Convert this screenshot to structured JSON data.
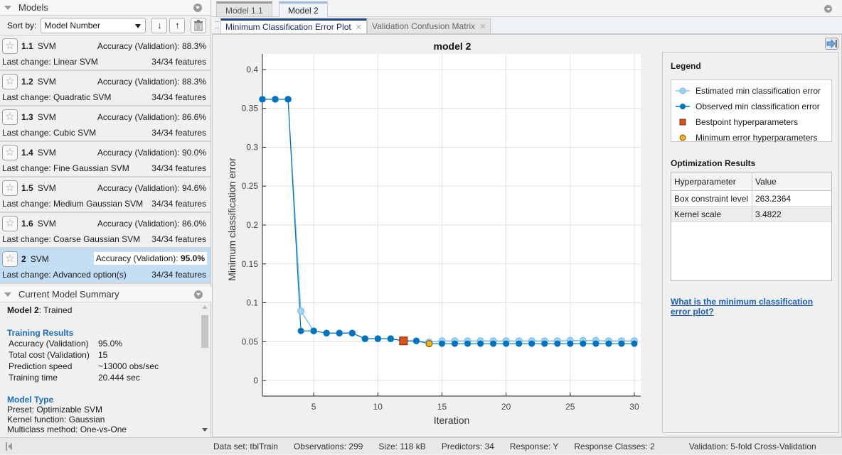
{
  "models_panel": {
    "title": "Models",
    "sort_label": "Sort by:",
    "sort_value": "Model Number",
    "models": [
      {
        "id": "1.1",
        "type": "SVM",
        "accuracy": "Accuracy (Validation): 88.3%",
        "last_change": "Last change: Linear SVM",
        "features": "34/34 features"
      },
      {
        "id": "1.2",
        "type": "SVM",
        "accuracy": "Accuracy (Validation): 88.3%",
        "last_change": "Last change: Quadratic SVM",
        "features": "34/34 features"
      },
      {
        "id": "1.3",
        "type": "SVM",
        "accuracy": "Accuracy (Validation): 86.6%",
        "last_change": "Last change: Cubic SVM",
        "features": "34/34 features"
      },
      {
        "id": "1.4",
        "type": "SVM",
        "accuracy": "Accuracy (Validation): 90.0%",
        "last_change": "Last change: Fine Gaussian SVM",
        "features": "34/34 features"
      },
      {
        "id": "1.5",
        "type": "SVM",
        "accuracy": "Accuracy (Validation): 94.6%",
        "last_change": "Last change: Medium Gaussian SVM",
        "features": "34/34 features"
      },
      {
        "id": "1.6",
        "type": "SVM",
        "accuracy": "Accuracy (Validation): 86.0%",
        "last_change": "Last change: Coarse Gaussian SVM",
        "features": "34/34 features"
      },
      {
        "id": "2",
        "type": "SVM",
        "accuracy_label": "Accuracy (Validation):",
        "accuracy_value": "95.0%",
        "last_change": "Last change: Advanced option(s)",
        "features": "34/34 features",
        "selected": true
      }
    ]
  },
  "summary_panel": {
    "title": "Current Model Summary",
    "model_name": "Model 2",
    "model_status": ": Trained",
    "training_results_title": "Training Results",
    "training_results": [
      {
        "k": "Accuracy (Validation)",
        "v": "95.0%"
      },
      {
        "k": "Total cost (Validation)",
        "v": "15"
      },
      {
        "k": "Prediction speed",
        "v": "~13000 obs/sec"
      },
      {
        "k": "Training time",
        "v": "20.444 sec"
      }
    ],
    "model_type_title": "Model Type",
    "model_type": [
      "Preset: Optimizable SVM",
      "Kernel function: Gaussian",
      "Multiclass method: One-vs-One"
    ]
  },
  "doc_tabs": [
    "Model 1.1",
    "Model 2"
  ],
  "plot_tabs": [
    "Minimum Classification Error Plot",
    "Validation Confusion Matrix"
  ],
  "side_panel": {
    "legend_title": "Legend",
    "legend": [
      "Estimated min classification error",
      "Observed min classification error",
      "Bestpoint hyperparameters",
      "Minimum error hyperparameters"
    ],
    "optimization_title": "Optimization Results",
    "table_headers": [
      "Hyperparameter",
      "Value"
    ],
    "table_rows": [
      [
        "Box constraint level",
        "263.2364"
      ],
      [
        "Kernel scale",
        "3.4822"
      ]
    ],
    "help_link": "What is the minimum classification error plot?"
  },
  "status_bar": {
    "dataset": "Data set: tblTrain",
    "observations": "Observations: 299",
    "size": "Size: 118 kB",
    "predictors": "Predictors: 34",
    "response": "Response: Y",
    "classes": "Response Classes: 2",
    "validation": "Validation: 5-fold Cross-Validation"
  },
  "colors": {
    "observed": "#0072bd",
    "estimated": "#9fd3f5",
    "bestpoint": "#d95319",
    "minerror": "#edb120",
    "selected_row": "#c3def4",
    "link": "#1a5fb4"
  },
  "chart_data": {
    "type": "line",
    "title": "model 2",
    "xlabel": "Iteration",
    "ylabel": "Minimum classification error",
    "xlim": [
      1,
      30.5
    ],
    "ylim": [
      -0.02,
      0.42
    ],
    "xticks": [
      5,
      10,
      15,
      20,
      25,
      30
    ],
    "yticks": [
      0,
      0.05,
      0.1,
      0.15,
      0.2,
      0.25,
      0.3,
      0.35,
      0.4
    ],
    "ytick_labels": [
      "0",
      "0.05",
      "0.1",
      "0.15",
      "0.2",
      "0.25",
      "0.3",
      "0.35",
      "0.4"
    ],
    "grid": true,
    "x": [
      1,
      2,
      3,
      4,
      5,
      6,
      7,
      8,
      9,
      10,
      11,
      12,
      13,
      14,
      15,
      16,
      17,
      18,
      19,
      20,
      21,
      22,
      23,
      24,
      25,
      26,
      27,
      28,
      29,
      30
    ],
    "series": [
      {
        "name": "Estimated min classification error",
        "values": [
          0.3617,
          0.3617,
          0.3617,
          0.0893,
          0.0638,
          0.061,
          0.061,
          0.061,
          0.0538,
          0.0538,
          0.0538,
          0.051,
          0.051,
          0.0495,
          0.051,
          0.051,
          0.051,
          0.051,
          0.051,
          0.051,
          0.051,
          0.051,
          0.051,
          0.051,
          0.0515,
          0.0515,
          0.0515,
          0.051,
          0.051,
          0.051
        ]
      },
      {
        "name": "Observed min classification error",
        "values": [
          0.3617,
          0.3617,
          0.3617,
          0.0638,
          0.0638,
          0.061,
          0.061,
          0.061,
          0.0538,
          0.0538,
          0.0538,
          0.051,
          0.051,
          0.0474,
          0.0474,
          0.0474,
          0.0474,
          0.0474,
          0.0474,
          0.0474,
          0.0474,
          0.0474,
          0.0474,
          0.0474,
          0.0474,
          0.0474,
          0.0474,
          0.0474,
          0.0474,
          0.0474
        ]
      }
    ],
    "bestpoint": {
      "x": 12,
      "y": 0.051
    },
    "min_error": {
      "x": 14,
      "y": 0.0474
    },
    "legend_placement": "side-panel"
  }
}
